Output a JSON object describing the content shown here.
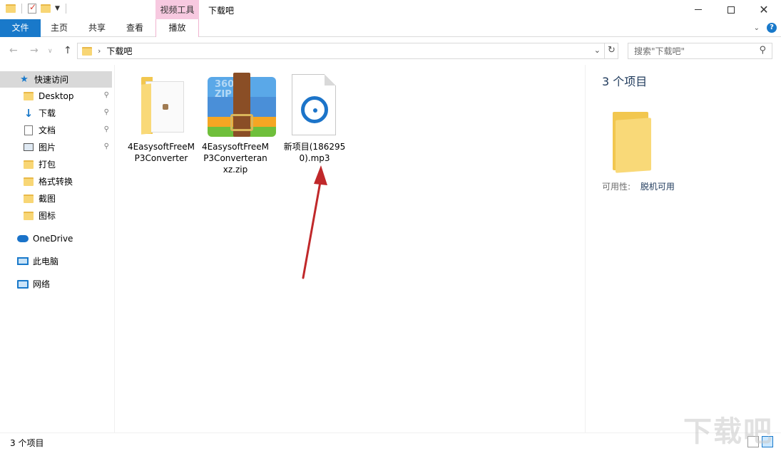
{
  "titlebar": {
    "context_tab_header": "视频工具",
    "title": "下载吧",
    "minimize_symbol": "",
    "maximize_symbol": "",
    "close_symbol": "✕"
  },
  "ribbon": {
    "tabs": [
      {
        "label": "文件"
      },
      {
        "label": "主页"
      },
      {
        "label": "共享"
      },
      {
        "label": "查看"
      },
      {
        "label": "播放"
      }
    ],
    "help": "?"
  },
  "address": {
    "path": "下载吧",
    "search_placeholder": "搜索\"下载吧\""
  },
  "sidebar": {
    "items": [
      {
        "label": "快速访问",
        "icon": "star-icon"
      },
      {
        "label": "Desktop",
        "icon": "folder-icon"
      },
      {
        "label": "下载",
        "icon": "download-arrow-icon"
      },
      {
        "label": "文档",
        "icon": "document-icon"
      },
      {
        "label": "图片",
        "icon": "picture-icon"
      },
      {
        "label": "打包",
        "icon": "folder-icon"
      },
      {
        "label": "格式转换",
        "icon": "folder-icon"
      },
      {
        "label": "截图",
        "icon": "folder-icon"
      },
      {
        "label": "图标",
        "icon": "folder-icon"
      },
      {
        "label": "OneDrive",
        "icon": "cloud-icon"
      },
      {
        "label": "此电脑",
        "icon": "computer-icon"
      },
      {
        "label": "网络",
        "icon": "network-icon"
      }
    ]
  },
  "files": [
    {
      "name": "4EasysoftFreeMP3Converter",
      "icon": "folder-icon"
    },
    {
      "name": "4EasysoftFreeMP3Converteranxz.zip",
      "icon": "zip-archive-icon",
      "badge": "360\nZIP"
    },
    {
      "name": "新项目(1862950).mp3",
      "icon": "mp3-file-icon"
    }
  ],
  "details": {
    "count": "3 个项目",
    "availability_label": "可用性:",
    "availability_value": "脱机可用"
  },
  "status": {
    "count": "3 个项目"
  },
  "watermark": "下载吧",
  "colors": {
    "accent": "#1979ca",
    "context_tab": "#f7c9e0",
    "folder": "#f9d978",
    "arrow": "#c0282a"
  }
}
